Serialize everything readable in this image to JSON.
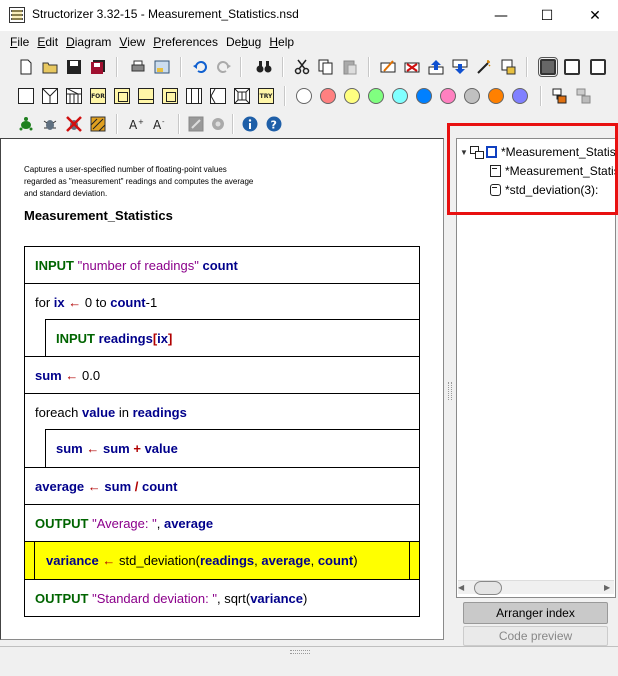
{
  "window": {
    "title": "Structorizer 3.32-15 - Measurement_Statistics.nsd",
    "minimize": "—",
    "maximize": "☐",
    "close": "✕"
  },
  "menu": [
    "File",
    "Edit",
    "Diagram",
    "View",
    "Preferences",
    "Debug",
    "Help"
  ],
  "menu_underline": [
    "F",
    "E",
    "D",
    "V",
    "P",
    "D",
    "H"
  ],
  "toolbar_colors": [
    "#ffffff",
    "#ff8080",
    "#ffff80",
    "#80ff80",
    "#80ffff",
    "#0080ff",
    "#ff80c0",
    "#c0c0c0",
    "#ff8000",
    "#8080ff"
  ],
  "diagram": {
    "description": [
      "Captures a user-specified number of floating-point values",
      "regarded as \"measurement\" readings and computes the average",
      "and standard deviation."
    ],
    "title": "Measurement_Statistics"
  },
  "tokens": {
    "INPUT": "INPUT",
    "OUTPUT": "OUTPUT",
    "for": "for",
    "to": "to",
    "foreach": "foreach",
    "in": "in",
    "assign": "←",
    "plus": "+",
    "div": "/",
    "comma": ",",
    "s_number_of_readings": "\"number of readings\"",
    "s_average": "\"Average: \"",
    "s_stddev": "\"Standard deviation: \"",
    "count": "count",
    "ix": "ix",
    "readings": "readings",
    "lbr": "[",
    "rbr": "]",
    "sum": "sum",
    "value": "value",
    "average": "average",
    "variance": "variance",
    "zero": "0",
    "minus1": "-1",
    "zero_float": "0.0",
    "std_call_open": "std_deviation(",
    "sqrt_open": "sqrt(",
    "close_paren": ")"
  },
  "tree": {
    "root": "*Measurement_Statistics",
    "item1": "*Measurement_Statistics",
    "item2": "*std_deviation(3):"
  },
  "tabs": {
    "arranger": "Arranger index",
    "preview": "Code preview"
  },
  "toolbar_labels": {
    "for": "FOR",
    "try": "TRY"
  }
}
